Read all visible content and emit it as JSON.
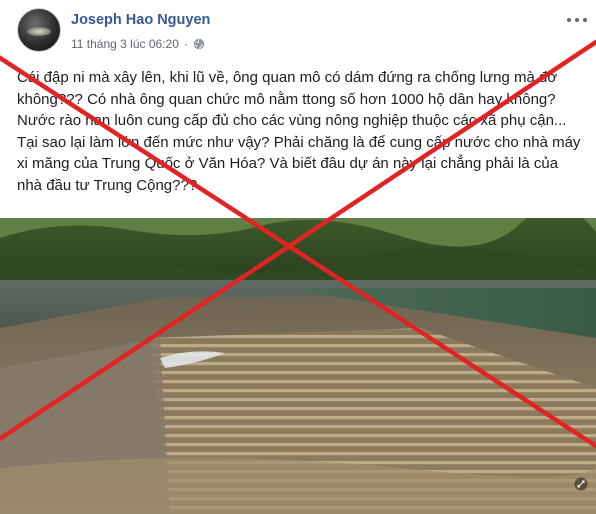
{
  "post": {
    "author": "Joseph Hao Nguyen",
    "timestamp": "11 tháng 3 lúc 06:20",
    "separator": "·",
    "privacy_icon": "globe-icon",
    "more_icon": "more-options-icon",
    "paragraphs": [
      "Cái đập ni mà xây lên, khi lũ về, ông quan mô có dám đứng ra chống lưng mà đỡ không??? Có nhà ông quan chức mô nằm ttong số hơn 1000 hộ dân hay không?",
      "Nước rào nan luôn cung cấp đủ cho các vùng nông nghiệp thuộc các xã phụ cận... Tại sao lại làm lớn đến mức như vậy? Phải chăng là để cung cấp nước cho nhà máy xi măng của Trung Quốc ở Văn Hóa? Và biết đâu dự án này lại chẳng phải là của nhà đầu tư Trung Cộng???"
    ],
    "photo_subject": "flooded dam spillway with river and forested hills",
    "expand_icon": "expand-icon"
  },
  "overlay": {
    "mark": "red-x-cross",
    "color": "#e02424"
  },
  "colors": {
    "author_link": "#385898",
    "meta_gray": "#616770",
    "text": "#1c1e21"
  }
}
